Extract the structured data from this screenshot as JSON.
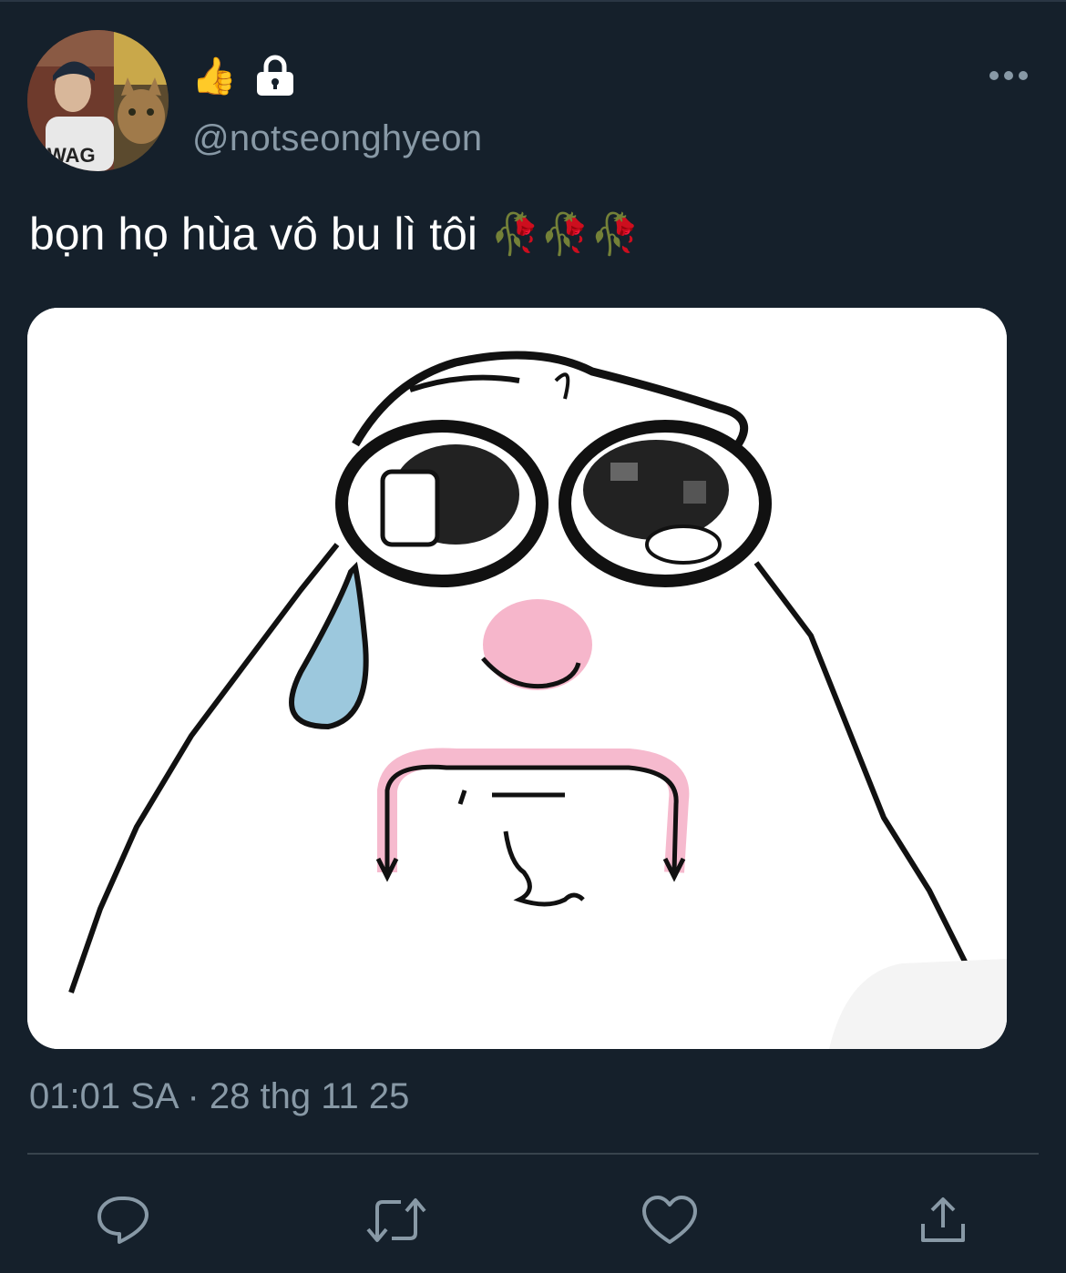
{
  "tweet": {
    "display_name_emoji": "👍",
    "protected_icon": "lock-icon",
    "handle": "@notseonghyeon",
    "text": "bọn họ hùa vô bu lì tôi",
    "text_emoji": "🥀🥀🥀",
    "avatar_caption": "WAG",
    "timestamp": "01:01 SA · 28 thg 11 25"
  },
  "actions": [
    {
      "name": "reply",
      "icon": "reply-icon"
    },
    {
      "name": "retweet",
      "icon": "retweet-icon"
    },
    {
      "name": "like",
      "icon": "heart-icon"
    },
    {
      "name": "share",
      "icon": "share-icon"
    }
  ],
  "colors": {
    "background": "#15202b",
    "secondary_text": "#8899a6",
    "divider": "#38444d",
    "text": "#ffffff"
  }
}
